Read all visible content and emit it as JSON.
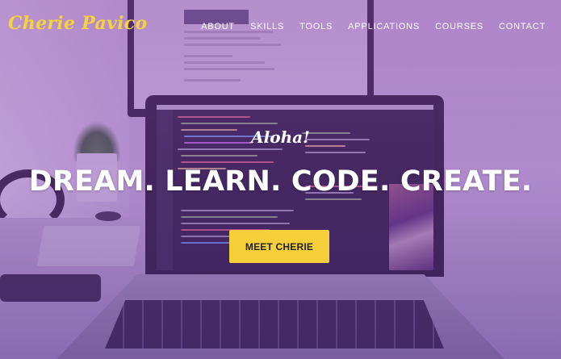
{
  "brand": {
    "logo_text": "Cherie Pavico",
    "accent_color": "#f4cf3a"
  },
  "nav": {
    "items": [
      {
        "label": "ABOUT"
      },
      {
        "label": "SKILLS"
      },
      {
        "label": "TOOLS"
      },
      {
        "label": "APPLICATIONS"
      },
      {
        "label": "COURSES"
      },
      {
        "label": "CONTACT"
      }
    ]
  },
  "hero": {
    "greeting": "Aloha!",
    "headline": "DREAM. LEARN. CODE. CREATE.",
    "cta_label": "MEET CHERIE",
    "overlay_color": "#7a3caa"
  }
}
